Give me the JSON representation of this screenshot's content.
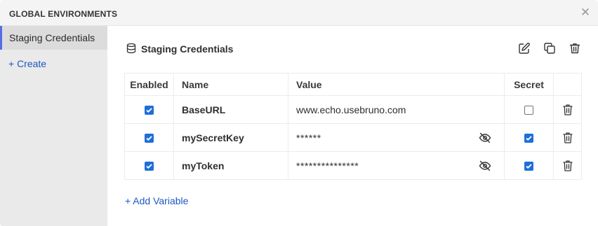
{
  "modal": {
    "title": "GLOBAL ENVIRONMENTS",
    "close_icon": "close-icon"
  },
  "sidebar": {
    "environments": [
      {
        "label": "Staging Credentials",
        "active": true
      }
    ],
    "create_label": "+ Create"
  },
  "environment": {
    "name": "Staging Credentials",
    "icon": "database-icon",
    "actions": [
      "edit-icon",
      "copy-icon",
      "trash-icon"
    ]
  },
  "table": {
    "headers": {
      "enabled": "Enabled",
      "name": "Name",
      "value": "Value",
      "secret": "Secret"
    },
    "rows": [
      {
        "enabled": true,
        "name": "BaseURL",
        "value": "www.echo.usebruno.com",
        "secret": false,
        "masked": false
      },
      {
        "enabled": true,
        "name": "mySecretKey",
        "value": "******",
        "secret": true,
        "masked": true,
        "toggle_icon": "eye-off-icon"
      },
      {
        "enabled": true,
        "name": "myToken",
        "value": "***************",
        "secret": true,
        "masked": true,
        "toggle_icon": "eye-off-icon"
      }
    ]
  },
  "add_variable_label": "+ Add Variable",
  "colors": {
    "accent": "#546de5",
    "link": "#1f57c3",
    "checkbox": "#1e6fd9"
  }
}
